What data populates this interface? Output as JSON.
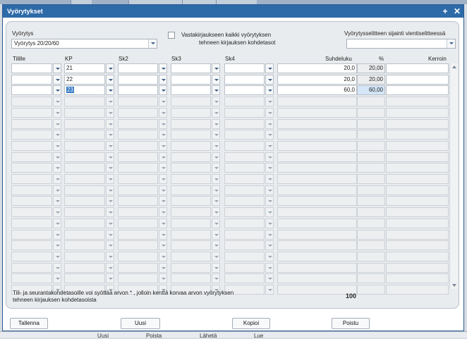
{
  "window": {
    "title": "Vyörytykset",
    "add_icon": "+",
    "close_icon": "✕"
  },
  "form": {
    "vyorytys_label": "Vyörytys",
    "vyorytys_value": "Vyörytys 20/20/60",
    "checkbox_label_line1": "Vastakirjaukseen kaikki vyörytyksen",
    "checkbox_label_line2": "tehneen kirjauksen kohdetasot",
    "checkbox_checked": false,
    "selite_label": "Vyörytysselitteen sijainti vientiselitteessä",
    "selite_value": ""
  },
  "grid": {
    "headers": {
      "tili": "Tilille",
      "kp": "KP",
      "sk2": "Sk2",
      "sk3": "Sk3",
      "sk4": "Sk4",
      "suhdeluku": "Suhdeluku",
      "pct": "%",
      "kerroin": "Kerroin"
    },
    "rows": [
      {
        "tili": "",
        "kp": "21",
        "sk2": "",
        "sk3": "",
        "sk4": "",
        "suhdeluku": "20,0",
        "pct": "20,00",
        "kerroin": ""
      },
      {
        "tili": "",
        "kp": "22",
        "sk2": "",
        "sk3": "",
        "sk4": "",
        "suhdeluku": "20,0",
        "pct": "20,00",
        "kerroin": ""
      },
      {
        "tili": "",
        "kp": "23",
        "sk2": "",
        "sk3": "",
        "sk4": "",
        "suhdeluku": "60,0",
        "pct": "60,00",
        "kerroin": ""
      }
    ],
    "empty_row_count": 18,
    "total": "100"
  },
  "note_text": "Tili- ja seurantakohdetasoille voi syöttää arvon * , jolloin kenttä korvaa arvon vyörytyksen tehneen kirjauksen kohdetasoista",
  "buttons": {
    "save": "Tallenna",
    "new": "Uusi",
    "copy": "Kopioi",
    "delete": "Poistu"
  },
  "background": {
    "bottom_labels": [
      "Uusi",
      "Poista",
      "Lähetä",
      "Lue"
    ]
  }
}
